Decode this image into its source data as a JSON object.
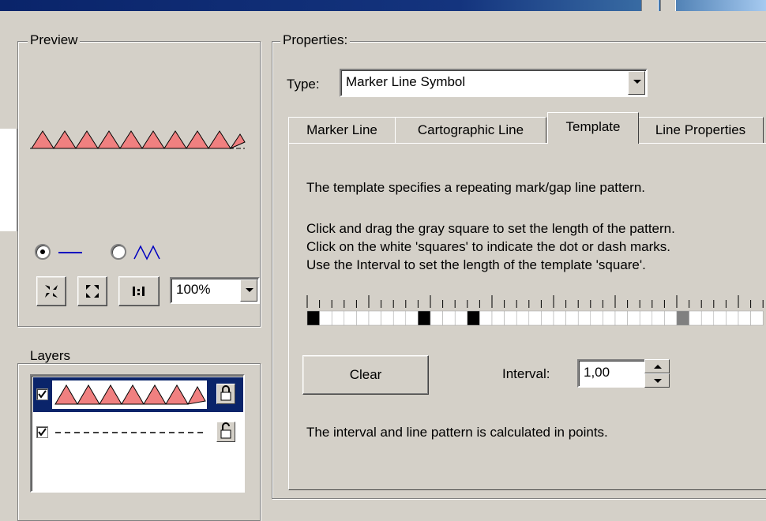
{
  "preview": {
    "label": "Preview",
    "zoom": {
      "value": "100%"
    },
    "mode_options": [
      {
        "name": "line-mode",
        "icon": "straight-line-icon",
        "selected": true
      },
      {
        "name": "zigzag-mode",
        "icon": "zigzag-icon",
        "selected": false
      }
    ],
    "tools": [
      "zoom-in-icon",
      "zoom-out-icon",
      "actual-size-icon"
    ]
  },
  "properties": {
    "label": "Properties:",
    "type_label": "Type:",
    "type_value": "Marker Line Symbol"
  },
  "tabs": [
    {
      "label": "Marker Line",
      "active": false
    },
    {
      "label": "Cartographic Line",
      "active": false
    },
    {
      "label": "Template",
      "active": true
    },
    {
      "label": "Line Properties",
      "active": false
    }
  ],
  "template": {
    "description": "The template specifies a repeating mark/gap line pattern.",
    "instructions": [
      "Click and drag the gray square to set the length of the pattern.",
      "Click on the white 'squares' to indicate the dot or dash marks.",
      "Use the Interval to set the length of the template 'square'."
    ],
    "pattern": [
      1,
      0,
      0,
      0,
      0,
      0,
      0,
      0,
      0,
      1,
      0,
      0,
      0,
      1,
      0,
      0,
      0,
      0,
      0,
      0,
      0,
      0,
      0,
      0,
      0,
      0,
      0,
      0,
      0,
      0,
      2,
      0,
      0,
      0,
      0,
      0,
      0
    ],
    "clear_label": "Clear",
    "interval_label": "Interval:",
    "interval_value": "1,00",
    "footer": "The interval and line pattern is calculated in points."
  },
  "layers": {
    "label": "Layers",
    "items": [
      {
        "name": "marker-layer",
        "checked": true,
        "locked": true,
        "selected": true
      },
      {
        "name": "dash-layer",
        "checked": true,
        "locked": false,
        "selected": false
      }
    ]
  },
  "colors": {
    "marker_fill": "#f08080",
    "selection": "#0a246a",
    "face": "#d4d0c8"
  }
}
